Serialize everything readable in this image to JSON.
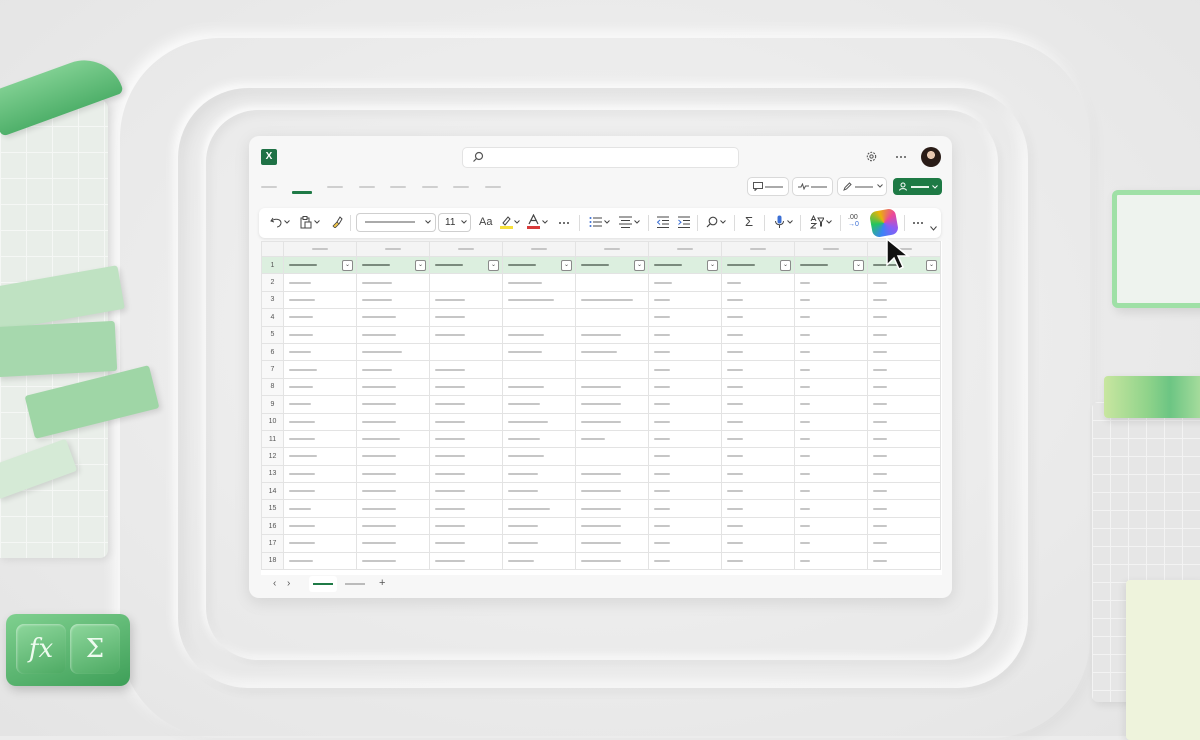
{
  "app": {
    "logo_letter": "X",
    "accent": "#1e7145"
  },
  "formula_keys": {
    "fx": "fx",
    "sum": "Σ"
  },
  "toolbar": {
    "font_size": "11",
    "aa_label": "Aa",
    "sum_glyph": "Σ",
    "decimal_label": ".00"
  },
  "sheet": {
    "row_numbers": [
      "1",
      "2",
      "3",
      "4",
      "5",
      "6",
      "7",
      "8",
      "9",
      "10",
      "11",
      "12",
      "13",
      "14",
      "15",
      "16",
      "17",
      "18"
    ]
  },
  "sheet_tabs": {
    "add": "+"
  },
  "icons": [
    "search-icon",
    "gear-icon",
    "more-icon",
    "undo-icon",
    "paste-icon",
    "format-painter-icon",
    "highlight-icon",
    "font-color-icon",
    "bullets-icon",
    "align-icon",
    "indent-icon",
    "find-icon",
    "dictate-icon",
    "sort-filter-icon",
    "copilot-icon",
    "cursor-icon"
  ]
}
